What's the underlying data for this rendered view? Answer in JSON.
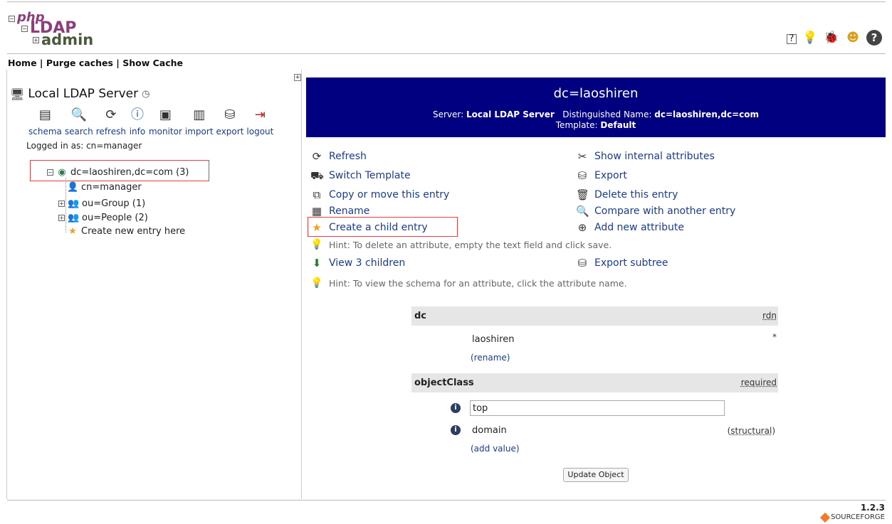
{
  "logo": {
    "php": "php",
    "ldap": "LDAP",
    "admin": "admin"
  },
  "nav": {
    "home": "Home",
    "purge": "Purge caches",
    "show_cache": "Show Cache",
    "sep": " | "
  },
  "top_icons": [
    "help-icon",
    "idea-icon",
    "bug-icon",
    "smiley-icon",
    "question-icon"
  ],
  "server": {
    "title": "Local LDAP Server",
    "tools": [
      {
        "label": "schema",
        "icon": "schema-icon"
      },
      {
        "label": "search",
        "icon": "search-icon"
      },
      {
        "label": "refresh",
        "icon": "refresh-icon"
      },
      {
        "label": "info",
        "icon": "info-icon"
      },
      {
        "label": "monitor",
        "icon": "monitor-icon"
      },
      {
        "label": "import",
        "icon": "import-icon"
      },
      {
        "label": "export",
        "icon": "export-icon"
      },
      {
        "label": "logout",
        "icon": "logout-icon"
      }
    ],
    "logged_in": "Logged in as: cn=manager"
  },
  "tree": {
    "root": "dc=laoshiren,dc=com (3)",
    "children": [
      {
        "label": "cn=manager"
      },
      {
        "label": "ou=Group (1)"
      },
      {
        "label": "ou=People (2)"
      },
      {
        "label": "Create new entry here"
      }
    ]
  },
  "entry": {
    "dn_title": "dc=laoshiren",
    "server_label": "Server:",
    "server_value": "Local LDAP Server",
    "dn_label": "Distinguished Name:",
    "dn_value": "dc=laoshiren,dc=com",
    "template_label": "Template:",
    "template_value": "Default"
  },
  "actions": {
    "refresh": "Refresh",
    "switch_template": "Switch Template",
    "copy_move": "Copy or move this entry",
    "rename": "Rename",
    "create_child": "Create a child entry",
    "hint_delete": "Hint: To delete an attribute, empty the text field and click save.",
    "view_children": "View 3 children",
    "hint_schema": "Hint: To view the schema for an attribute, click the attribute name.",
    "show_internal": "Show internal attributes",
    "export": "Export",
    "delete_entry": "Delete this entry",
    "compare": "Compare with another entry",
    "add_attribute": "Add new attribute",
    "export_subtree": "Export subtree"
  },
  "attributes": {
    "dc": {
      "name": "dc",
      "tag": "rdn",
      "value": "laoshiren",
      "required_mark": "*",
      "rename_link": "(rename)"
    },
    "objectClass": {
      "name": "objectClass",
      "tag": "required",
      "values": [
        "top",
        "domain"
      ],
      "structural": "structural",
      "add_value_link": "(add value)"
    }
  },
  "update_button": "Update Object",
  "footer": {
    "version": "1.2.3",
    "sourceforge": "SOURCEFORGE"
  }
}
